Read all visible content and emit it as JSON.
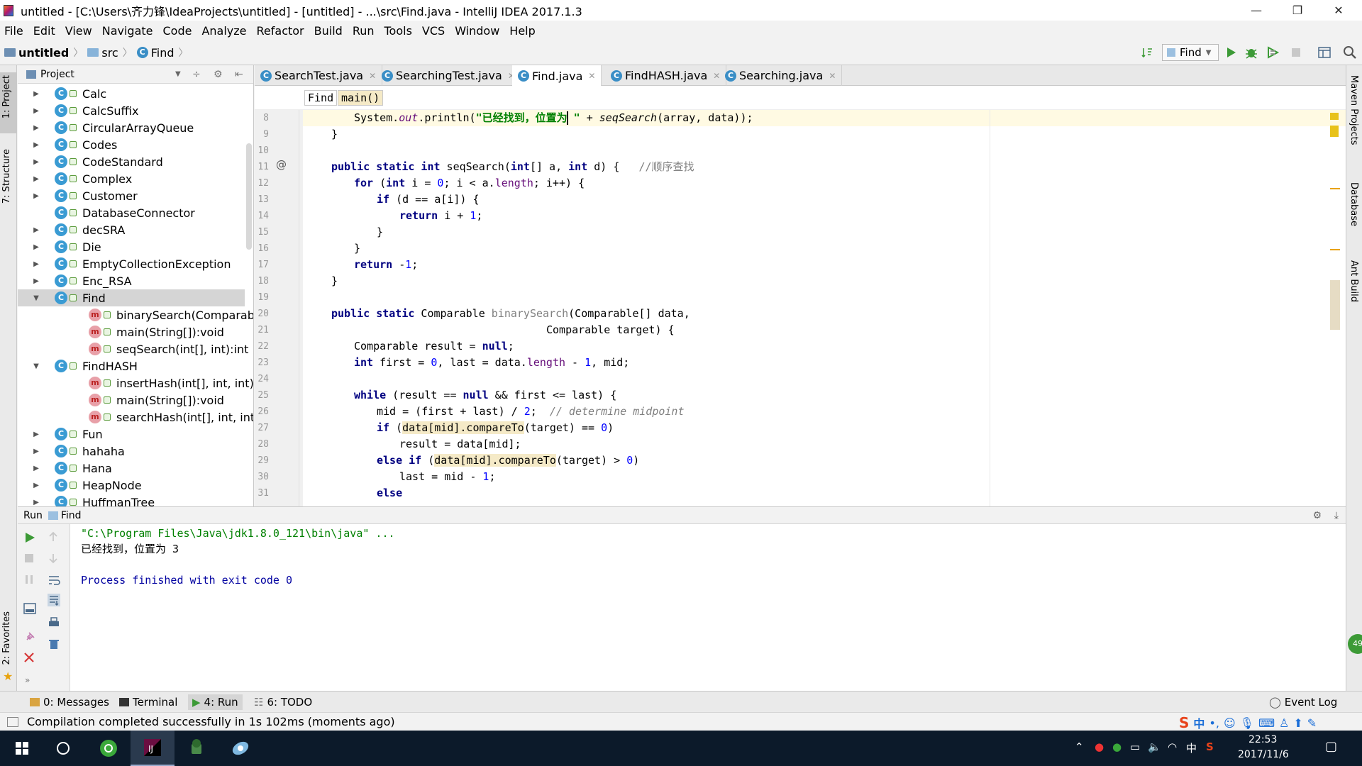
{
  "window": {
    "title": "untitled - [C:\\Users\\齐力锋\\IdeaProjects\\untitled] - [untitled] - ...\\src\\Find.java - IntelliJ IDEA 2017.1.3",
    "minimize": "—",
    "restore": "❐",
    "close": "✕"
  },
  "menu": [
    "File",
    "Edit",
    "View",
    "Navigate",
    "Code",
    "Analyze",
    "Refactor",
    "Build",
    "Run",
    "Tools",
    "VCS",
    "Window",
    "Help"
  ],
  "nav": {
    "project": "untitled",
    "folder": "src",
    "file": "Find",
    "run_config": "Find"
  },
  "left_stripe": {
    "project_tab": "1: Project",
    "structure_tab": "7: Structure",
    "favorites_tab": "2: Favorites"
  },
  "right_stripe": {
    "maven": "Maven Projects",
    "database": "Database",
    "ant": "Ant Build"
  },
  "project_panel": {
    "title": "Project",
    "tree": [
      {
        "label": "Calc",
        "type": "class",
        "expanded": false
      },
      {
        "label": "CalcSuffix",
        "type": "class",
        "expanded": false
      },
      {
        "label": "CircularArrayQueue",
        "type": "class",
        "expanded": false
      },
      {
        "label": "Codes",
        "type": "class",
        "expanded": false
      },
      {
        "label": "CodeStandard",
        "type": "class",
        "expanded": false
      },
      {
        "label": "Complex",
        "type": "class",
        "expanded": false
      },
      {
        "label": "Customer",
        "type": "class",
        "expanded": false
      },
      {
        "label": "DatabaseConnector",
        "type": "class",
        "expanded": false
      },
      {
        "label": "decSRA",
        "type": "class",
        "expanded": false
      },
      {
        "label": "Die",
        "type": "class",
        "expanded": false
      },
      {
        "label": "EmptyCollectionException",
        "type": "class",
        "expanded": false
      },
      {
        "label": "Enc_RSA",
        "type": "class",
        "expanded": false
      },
      {
        "label": "Find",
        "type": "class",
        "expanded": true,
        "selected": true
      },
      {
        "label": "binarySearch(Comparable",
        "type": "method"
      },
      {
        "label": "main(String[]):void",
        "type": "method"
      },
      {
        "label": "seqSearch(int[], int):int",
        "type": "method"
      },
      {
        "label": "FindHASH",
        "type": "class",
        "expanded": true
      },
      {
        "label": "insertHash(int[], int, int):v",
        "type": "method"
      },
      {
        "label": "main(String[]):void",
        "type": "method"
      },
      {
        "label": "searchHash(int[], int, int):i",
        "type": "method"
      },
      {
        "label": "Fun",
        "type": "class",
        "expanded": false
      },
      {
        "label": "hahaha",
        "type": "class",
        "expanded": false
      },
      {
        "label": "Hana",
        "type": "class",
        "expanded": false
      },
      {
        "label": "HeapNode",
        "type": "class",
        "expanded": false
      },
      {
        "label": "HuffmanTree",
        "type": "class",
        "expanded": false
      }
    ]
  },
  "editor_tabs": [
    {
      "label": "SearchTest.java",
      "active": false
    },
    {
      "label": "SearchingTest.java",
      "active": false
    },
    {
      "label": "Find.java",
      "active": true
    },
    {
      "label": "FindHASH.java",
      "active": false
    },
    {
      "label": "Searching.java",
      "active": false
    }
  ],
  "editor_breadcrumb": [
    "Find",
    "main()"
  ],
  "code_lines": [
    {
      "n": "8"
    },
    {
      "n": "9"
    },
    {
      "n": "10"
    },
    {
      "n": "11"
    },
    {
      "n": "12"
    },
    {
      "n": "13"
    },
    {
      "n": "14"
    },
    {
      "n": "15"
    },
    {
      "n": "16"
    },
    {
      "n": "17"
    },
    {
      "n": "18"
    },
    {
      "n": "19"
    },
    {
      "n": "20"
    },
    {
      "n": "21"
    },
    {
      "n": "22"
    },
    {
      "n": "23"
    },
    {
      "n": "24"
    },
    {
      "n": "25"
    },
    {
      "n": "26"
    },
    {
      "n": "27"
    },
    {
      "n": "28"
    },
    {
      "n": "29"
    },
    {
      "n": "30"
    },
    {
      "n": "31"
    }
  ],
  "code": {
    "l8_a": "System.",
    "l8_b": "out",
    "l8_c": ".println(",
    "l8_d": "\"已经找到，位置为 \"",
    "l8_e": " + ",
    "l8_f": "seqSearch",
    "l8_g": "(array, data));",
    "l9": "}",
    "l11_kw": "public static int",
    "l11_a": " seqSearch(",
    "l11_kw2": "int",
    "l11_b": "[] a, ",
    "l11_kw3": "int",
    "l11_c": " d) {   ",
    "l11_cmt": "//顺序查找",
    "l12_kw": "for",
    "l12_a": " (",
    "l12_kw2": "int",
    "l12_b": " i = ",
    "l12_n": "0",
    "l12_c": "; i < a.",
    "l12_f": "length",
    "l12_d": "; i++) {",
    "l13_kw": "if",
    "l13_a": " (d == a[i]) {",
    "l14_kw": "return",
    "l14_a": " i + ",
    "l14_n": "1",
    "l14_b": ";",
    "l15": "}",
    "l16": "}",
    "l17_kw": "return",
    "l17_a": " -",
    "l17_n": "1",
    "l17_b": ";",
    "l18": "}",
    "l20_kw": "public static",
    "l20_a": " Comparable ",
    "l20_un": "binarySearch",
    "l20_b": "(Comparable[] data,",
    "l21": "Comparable target) {",
    "l22_a": "Comparable result = ",
    "l22_kw": "null",
    "l22_b": ";",
    "l23_kw": "int",
    "l23_a": " first = ",
    "l23_n": "0",
    "l23_b": ", last = data.",
    "l23_f": "length",
    "l23_c": " - ",
    "l23_n2": "1",
    "l23_d": ", mid;",
    "l25_kw": "while",
    "l25_a": " (result == ",
    "l25_kw2": "null",
    "l25_b": " && first <= last) {",
    "l26_a": "mid = (first + last) / ",
    "l26_n": "2",
    "l26_b": ";  ",
    "l26_cmt": "// determine midpoint",
    "l27_kw": "if",
    "l27_a": " (",
    "l27_hl": "data[mid].compareTo",
    "l27_b": "(target) == ",
    "l27_n": "0",
    "l27_c": ")",
    "l28": "result = data[mid];",
    "l29_kw": "else if",
    "l29_a": " (",
    "l29_hl": "data[mid].compareTo",
    "l29_b": "(target) > ",
    "l29_n": "0",
    "l29_c": ")",
    "l30_a": "last = mid - ",
    "l30_n": "1",
    "l30_b": ";",
    "l31_kw": "else"
  },
  "run_panel": {
    "title_run": "Run",
    "title_find": "Find",
    "console": [
      "\"C:\\Program Files\\Java\\jdk1.8.0_121\\bin\\java\" ...",
      "已经找到，位置为 3",
      "",
      "Process finished with exit code 0"
    ]
  },
  "tool_tabs": {
    "messages": "0: Messages",
    "terminal": "Terminal",
    "run": "4: Run",
    "todo": "6: TODO",
    "event_log": "Event Log"
  },
  "status": "Compilation completed successfully in 1s 102ms (moments ago)",
  "taskbar": {
    "time": "22:53",
    "date": "2017/11/6",
    "ime": "中",
    "badge": "49"
  },
  "colors": {
    "keyword": "#000080",
    "string": "#008000",
    "number": "#0000ff",
    "comment": "#808080",
    "field": "#660e7a",
    "run_green": "#3c9a36"
  }
}
